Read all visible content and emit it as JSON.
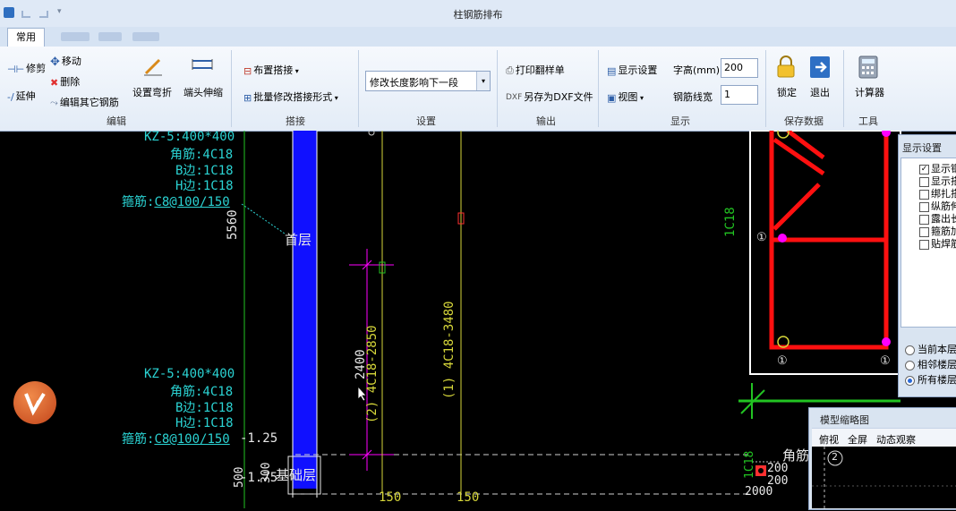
{
  "window": {
    "title": "柱钢筋排布"
  },
  "tabs": [
    {
      "label": "常用",
      "active": true
    }
  ],
  "ribbon": {
    "edit": {
      "group_label": "编辑",
      "trim": "修剪",
      "move": "移动",
      "extend": "延伸",
      "delete": "删除",
      "edit_other": "编辑其它钢筋",
      "set_bend": "设置弯折",
      "end_extend": "端头伸缩"
    },
    "lap": {
      "group_label": "搭接",
      "place_lap": "布置搭接",
      "batch_modify": "批量修改搭接形式"
    },
    "settings": {
      "group_label": "设置",
      "dropdown_value": "修改长度影响下一段"
    },
    "output": {
      "group_label": "输出",
      "print": "打印翻样单",
      "save_dxf": "另存为DXF文件"
    },
    "display": {
      "group_label": "显示",
      "display_settings": "显示设置",
      "view": "视图",
      "font_height_label": "字高(mm)",
      "font_height_value": "200",
      "line_width_label": "钢筋线宽",
      "line_width_value": "1"
    },
    "save_data": {
      "group_label": "保存数据",
      "lock": "锁定",
      "exit": "退出"
    },
    "tools": {
      "group_label": "工具",
      "calculator": "计算器"
    }
  },
  "canvas": {
    "upper_col": {
      "id": "KZ-5:400*400",
      "corner": "角筋:4C18",
      "b_side": "B边:1C18",
      "h_side": "H边:1C18",
      "stirrup_label": "箍筋:",
      "stirrup_value": "C8@100/150"
    },
    "lower_col": {
      "id": "KZ-5:400*400",
      "corner": "角筋:4C18",
      "b_side": "B边:1C18",
      "h_side": "H边:1C18",
      "stirrup_label": "箍筋:",
      "stirrup_value": "C8@100/150"
    },
    "dim_5560": "5560",
    "floor_first": "首层",
    "floor_base": "基础层",
    "dim_2400": "2400",
    "rebar_2": "(2) 4C18-2850",
    "rebar_1": "(1) 4C18-3480",
    "elev_125": "-1.25",
    "elev_175": "-1.75",
    "dim_500": "500",
    "dim_300": "300",
    "dim_150a": "150",
    "dim_150b": "150",
    "section_rebar": "1C18",
    "marker_1": "①",
    "small_1c18": "1C18",
    "corner_text": "角筋",
    "dim_200a": "200",
    "dim_200b": "200",
    "dim_2000": "2000"
  },
  "display_panel": {
    "title": "显示设置",
    "items": [
      {
        "label": "显示钢",
        "checked": true
      },
      {
        "label": "显示搭",
        "checked": false
      },
      {
        "label": "绑扎搭",
        "checked": false
      },
      {
        "label": "纵筋伸",
        "checked": false
      },
      {
        "label": "露出长",
        "checked": false
      },
      {
        "label": "箍筋加",
        "checked": false
      },
      {
        "label": "贴焊筋",
        "checked": false
      }
    ],
    "radios": [
      {
        "label": "当前本层",
        "selected": false
      },
      {
        "label": "相邻楼层",
        "selected": false
      },
      {
        "label": "所有楼层",
        "selected": true
      }
    ]
  },
  "model_panel": {
    "title": "模型缩略图",
    "top_view": "俯视",
    "fullscreen": "全屏",
    "dynamic": "动态观察",
    "marker": "2"
  },
  "colors": {
    "cyan": "#2bd3d3",
    "blue_column": "#1010ff",
    "red_rebar": "#ff1010",
    "yellow_line": "#d6d63a",
    "green_dim": "#22c322",
    "magenta": "#ff00ff"
  }
}
